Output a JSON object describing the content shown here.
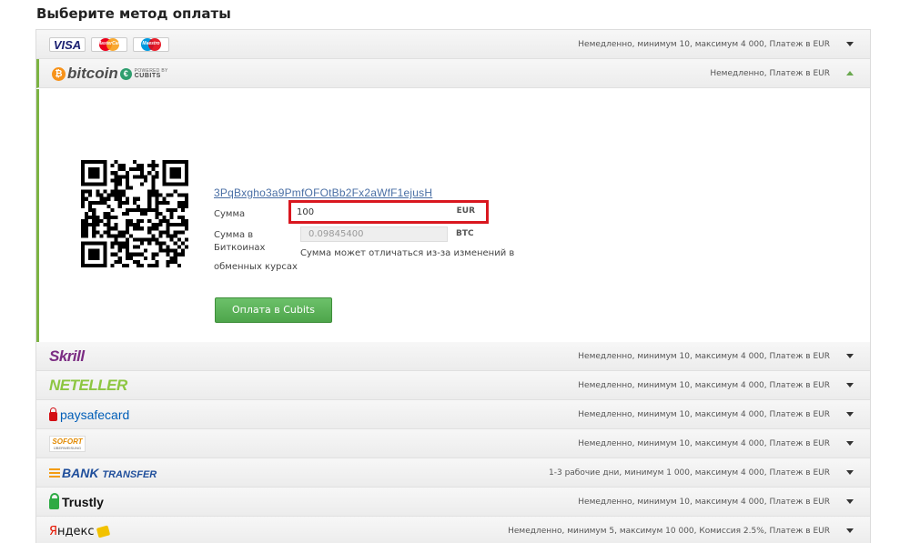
{
  "page": {
    "title": "Выберите метод оплаты"
  },
  "methods": {
    "cards": {
      "info": "Немедленно, минимум 10, максимум 4 000, Платеж в EUR",
      "visa": "VISA",
      "mastercard": "MasterCard",
      "maestro": "Maestro"
    },
    "bitcoin": {
      "info": "Немедленно, Платеж в EUR",
      "logo_text": "bitcoin",
      "logo_coin": "₿",
      "logo_euro": "€",
      "logo_powered": "POWERED BY",
      "logo_cubits": "CUBITS",
      "address": "3PqBxgho3a9PmfOFOtBb2Fx2aWfF1ejusH",
      "amount_label": "Сумма",
      "amount_value": "100",
      "amount_currency": "EUR",
      "btc_label_1": "Сумма в",
      "btc_label_2": "Биткоинах",
      "btc_label_3": "обменных курсах",
      "btc_value": "0.09845400",
      "btc_currency": "BTC",
      "note": "Сумма может отличаться из-за изменений в",
      "pay_button": "Оплата в Cubits"
    },
    "skrill": {
      "logo": "Skrill",
      "info": "Немедленно, минимум 10, максимум 4 000, Платеж в EUR"
    },
    "neteller": {
      "logo": "NETELLER",
      "info": "Немедленно, минимум 10, максимум 4 000, Платеж в EUR"
    },
    "paysafecard": {
      "logo_a": "paysafe",
      "logo_b": "card",
      "info": "Немедленно, минимум 10, максимум 4 000, Платеж в EUR"
    },
    "sofort": {
      "logo_a": "SOFORT",
      "logo_b": "ÜBERWEISUNG",
      "info": "Немедленно, минимум 10, максимум 4 000, Платеж в EUR"
    },
    "bank": {
      "logo_a": "BANK",
      "logo_b": "TRANSFER",
      "info": "1-3 рабочие дни, минимум 1 000, максимум 4 000, Платеж в EUR"
    },
    "trustly": {
      "logo": "Trustly",
      "info": "Немедленно, минимум 10, максимум 4 000, Платеж в EUR"
    },
    "yandex": {
      "logo_a": "Я",
      "logo_b": "ндекс",
      "info": "Немедленно, минимум 5, максимум 10 000, Комиссия 2.5%, Платеж в EUR"
    }
  },
  "colors": {
    "accent_green": "#7cb342",
    "highlight_red": "#d9171f",
    "link_blue": "#4a6fa5",
    "button_green": "#5cb85c"
  }
}
